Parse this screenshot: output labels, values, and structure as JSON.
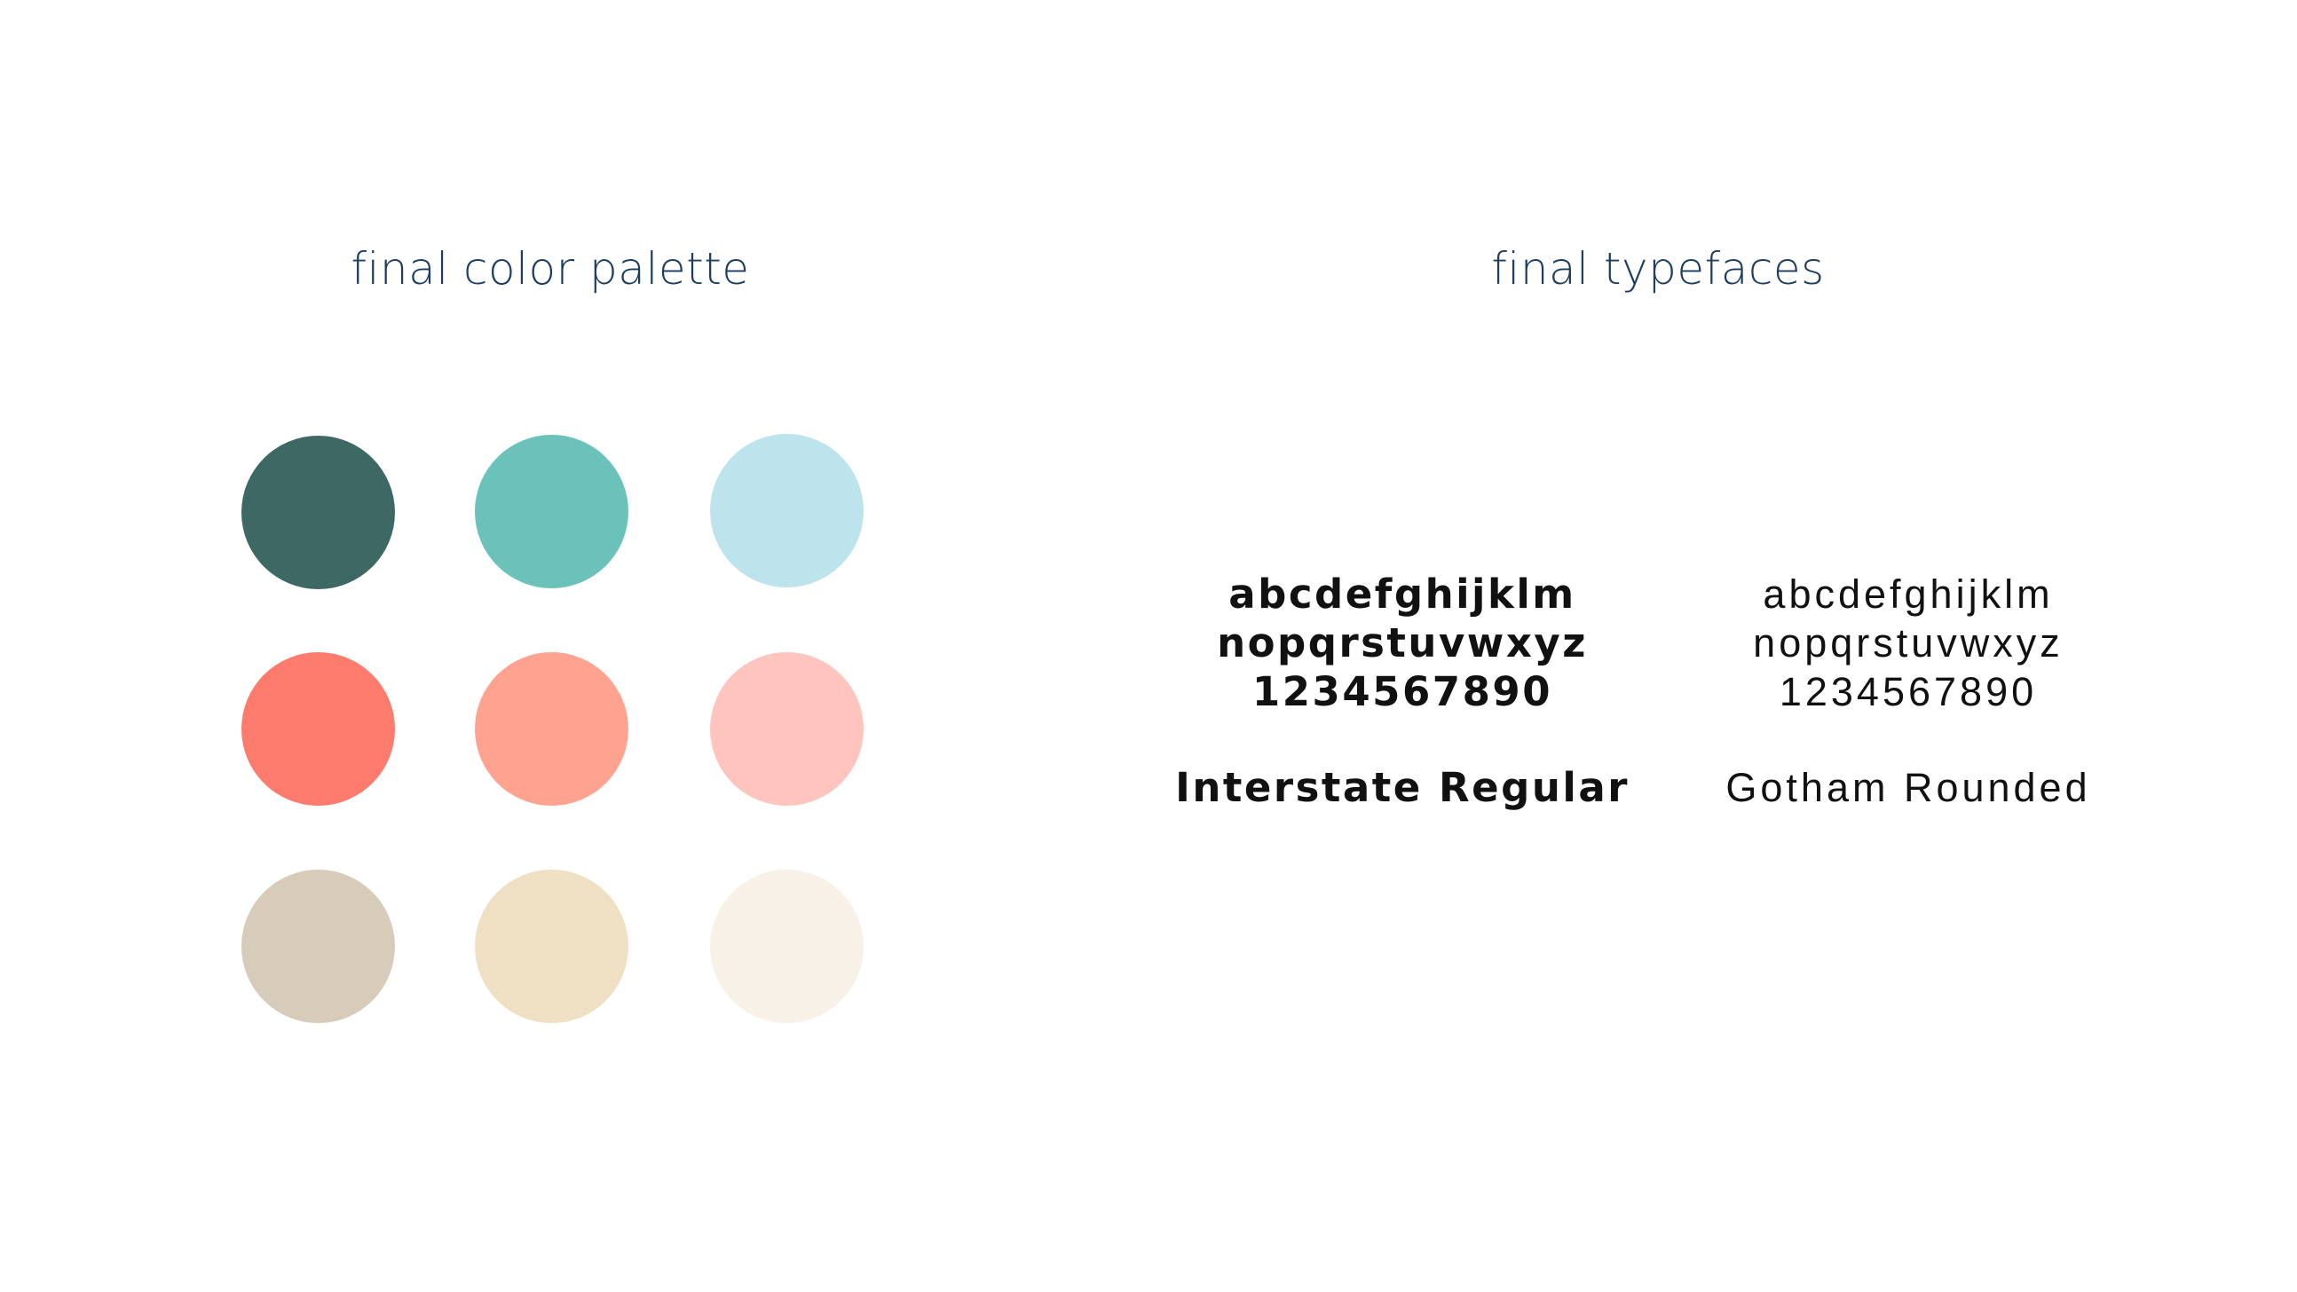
{
  "palette": {
    "title": "final color palette",
    "swatches": [
      {
        "name": "dark-teal",
        "color": "#3d6864"
      },
      {
        "name": "teal",
        "color": "#6bc2ba"
      },
      {
        "name": "light-blue",
        "color": "#bde3ec"
      },
      {
        "name": "coral",
        "color": "#fd7b6d"
      },
      {
        "name": "salmon",
        "color": "#ffa290"
      },
      {
        "name": "light-pink",
        "color": "#fec4bd"
      },
      {
        "name": "warm-gray",
        "color": "#d6ccb9"
      },
      {
        "name": "sand",
        "color": "#efdfc3"
      },
      {
        "name": "cream",
        "color": "#f7f1e7"
      }
    ]
  },
  "typefaces": {
    "title": "final typefaces",
    "items": [
      {
        "lines": [
          "abcdefghijklm",
          "nopqrstuvwxyz",
          "1234567890"
        ],
        "name": "Interstate Regular"
      },
      {
        "lines": [
          "abcdefghijklm",
          "nopqrstuvwxyz",
          "1234567890"
        ],
        "name": "Gotham Rounded"
      }
    ]
  },
  "colors": {
    "title_text": "#1d3e62",
    "specimen_text": "#111111",
    "background": "#ffffff"
  }
}
